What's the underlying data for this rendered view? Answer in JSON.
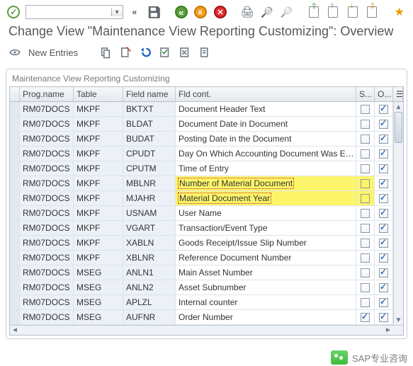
{
  "title": "Change View \"Maintenance View Reporting Customizing\": Overview",
  "sub": {
    "new_entries": "New Entries"
  },
  "panel_title": "Maintenance View Reporting Customizing",
  "head": {
    "prog": "Prog.name",
    "table": "Table",
    "field": "Field name",
    "desc": "Fld cont.",
    "s": "S...",
    "o": "O..."
  },
  "rows": [
    {
      "prog": "RM07DOCS",
      "table": "MKPF",
      "field": "BKTXT",
      "desc": "Document Header Text",
      "s": false,
      "o": true,
      "hl": false
    },
    {
      "prog": "RM07DOCS",
      "table": "MKPF",
      "field": "BLDAT",
      "desc": "Document Date in Document",
      "s": false,
      "o": true,
      "hl": false
    },
    {
      "prog": "RM07DOCS",
      "table": "MKPF",
      "field": "BUDAT",
      "desc": "Posting Date in the Document",
      "s": false,
      "o": true,
      "hl": false
    },
    {
      "prog": "RM07DOCS",
      "table": "MKPF",
      "field": "CPUDT",
      "desc": "Day On Which Accounting Document Was E…",
      "s": false,
      "o": true,
      "hl": false
    },
    {
      "prog": "RM07DOCS",
      "table": "MKPF",
      "field": "CPUTM",
      "desc": "Time of Entry",
      "s": false,
      "o": true,
      "hl": false
    },
    {
      "prog": "RM07DOCS",
      "table": "MKPF",
      "field": "MBLNR",
      "desc": "Number of Material Document",
      "s": false,
      "o": true,
      "hl": true
    },
    {
      "prog": "RM07DOCS",
      "table": "MKPF",
      "field": "MJAHR",
      "desc": "Material Document Year",
      "s": false,
      "o": true,
      "hl": true
    },
    {
      "prog": "RM07DOCS",
      "table": "MKPF",
      "field": "USNAM",
      "desc": "User Name",
      "s": false,
      "o": true,
      "hl": false
    },
    {
      "prog": "RM07DOCS",
      "table": "MKPF",
      "field": "VGART",
      "desc": "Transaction/Event Type",
      "s": false,
      "o": true,
      "hl": false
    },
    {
      "prog": "RM07DOCS",
      "table": "MKPF",
      "field": "XABLN",
      "desc": "Goods Receipt/Issue Slip Number",
      "s": false,
      "o": true,
      "hl": false
    },
    {
      "prog": "RM07DOCS",
      "table": "MKPF",
      "field": "XBLNR",
      "desc": "Reference Document Number",
      "s": false,
      "o": true,
      "hl": false
    },
    {
      "prog": "RM07DOCS",
      "table": "MSEG",
      "field": "ANLN1",
      "desc": "Main Asset Number",
      "s": false,
      "o": true,
      "hl": false
    },
    {
      "prog": "RM07DOCS",
      "table": "MSEG",
      "field": "ANLN2",
      "desc": "Asset Subnumber",
      "s": false,
      "o": true,
      "hl": false
    },
    {
      "prog": "RM07DOCS",
      "table": "MSEG",
      "field": "APLZL",
      "desc": "Internal counter",
      "s": false,
      "o": true,
      "hl": false
    },
    {
      "prog": "RM07DOCS",
      "table": "MSEG",
      "field": "AUFNR",
      "desc": "Order Number",
      "s": true,
      "o": true,
      "hl": false
    }
  ],
  "footer": "SAP专业咨询"
}
